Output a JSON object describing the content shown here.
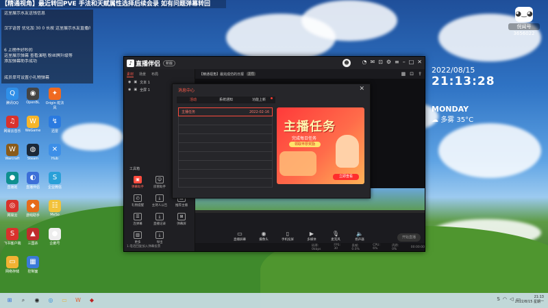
{
  "banner_text": "【精通视角】最近转回PVE 手法和天赋属性选择后续会录 如有问题弹幕转回",
  "chat": [
    "这里展示水友送钱信息",
    "汉字语音  优化加 30 0 长按 这里展示水友直播间",
    "6 上榜件好吵的",
    "这里展示弹幕  查看演唱  粉丝牌升级等",
    "添加弹幕助手成功",
    "成员单可设置小礼物弹幕"
  ],
  "desktop_icons": [
    {
      "label": "腾讯QQ",
      "glyph": "Q",
      "color": "#2f8fe8"
    },
    {
      "label": "OpenBL",
      "glyph": "◉",
      "color": "#444"
    },
    {
      "label": "Origin 蛇法风",
      "glyph": "✦",
      "color": "#f06a20"
    },
    {
      "label": "网易云音乐",
      "glyph": "♫",
      "color": "#d8322c"
    },
    {
      "label": "WeGame",
      "glyph": "W",
      "color": "#f6b52b"
    },
    {
      "label": "迅雷",
      "glyph": "↯",
      "color": "#2a7ae0"
    },
    {
      "label": "Warcraft",
      "glyph": "W",
      "color": "#8a5b1a"
    },
    {
      "label": "Steam",
      "glyph": "◍",
      "color": "#1b2838"
    },
    {
      "label": "Hub",
      "glyph": "✕",
      "color": "#3d8fe8"
    },
    {
      "label": "直播姬",
      "glyph": "●",
      "color": "#0f8f8f"
    },
    {
      "label": "直播伴侣",
      "glyph": "◐",
      "color": "#3c6fd8"
    },
    {
      "label": "企业微信",
      "glyph": "S",
      "color": "#2aa0d8"
    },
    {
      "label": "网易云",
      "glyph": "◎",
      "color": "#d8322c"
    },
    {
      "label": "游戏助手",
      "glyph": "◆",
      "color": "#e66b1a"
    },
    {
      "label": "MeSo",
      "glyph": "☷",
      "color": "#f2c23a"
    },
    {
      "label": "飞书客户端",
      "glyph": "S",
      "color": "#d8322c"
    },
    {
      "label": "三国杀",
      "glyph": "▲",
      "color": "#c02c2c"
    },
    {
      "label": "企鹅号",
      "glyph": "●",
      "color": "#eee"
    },
    {
      "label": "网络存储",
      "glyph": "▭",
      "color": "#f2b233"
    },
    {
      "label": "控制面",
      "glyph": "▦",
      "color": "#3a7ad8"
    }
  ],
  "clock": {
    "date": "2022/08/15",
    "time": "21:13:28",
    "day": "MONDAY",
    "weather": "多雾 35°C"
  },
  "profile": {
    "name": "倪闻号",
    "id": "3656022",
    "avatar": "◕‿◕"
  },
  "app": {
    "title": "直播伴侣",
    "version": "新版",
    "left_tabs": [
      "素材",
      "场景",
      "布局"
    ],
    "scenes": [
      "文本 1",
      "全屏 1"
    ],
    "tools_title": "工具箱",
    "tools": [
      {
        "label": "弹幕助手",
        "glyph": "▣",
        "active": true
      },
      {
        "label": "房管助手",
        "glyph": "☺",
        "active": false
      },
      {
        "label": "投屏主播",
        "glyph": "◧",
        "active": false
      },
      {
        "label": "礼物提醒",
        "glyph": "◴",
        "active": false
      },
      {
        "label": "主持人公告",
        "glyph": "⤓",
        "active": false
      },
      {
        "label": "推荐主播",
        "glyph": "▤",
        "active": false
      },
      {
        "label": "连弹幕",
        "glyph": "☰",
        "active": false
      },
      {
        "label": "直播记录",
        "glyph": "⤓",
        "active": false
      },
      {
        "label": "弹幕屏",
        "glyph": "⊞",
        "active": false
      },
      {
        "label": "更多",
        "glyph": "▥",
        "active": false
      },
      {
        "label": "导出",
        "glyph": "⤓",
        "active": false
      }
    ],
    "left_footer": "1.电话回复加入弹幕投票",
    "live_title": "【精通视角】最完成仿的日报",
    "live_tag": "正在",
    "controls": [
      {
        "label": "直播屏幕",
        "glyph": "▭"
      },
      {
        "label": "摄像头",
        "glyph": "◉"
      },
      {
        "label": "手机投屏",
        "glyph": "▯"
      },
      {
        "label": "多媒体",
        "glyph": "▶"
      },
      {
        "label": "麦克风",
        "glyph": "🎙"
      },
      {
        "label": "扬声器",
        "glyph": "🔈"
      }
    ],
    "start_live": "开始直播",
    "status": [
      "码率: 0kbps",
      "FPS: 30",
      "丢帧: 0.0%",
      "CPU: 6%",
      "内存: 0%",
      "00:00:00"
    ]
  },
  "modal": {
    "title": "消息中心",
    "tabs": [
      {
        "label": "活动",
        "active": true,
        "dot": false
      },
      {
        "label": "系统通知",
        "active": false,
        "dot": false
      },
      {
        "label": "功能上新",
        "active": false,
        "dot": true
      }
    ],
    "messages": [
      {
        "title": "主播任务",
        "date": "2022-02-16",
        "active": true
      },
      {
        "title": "",
        "date": "",
        "active": false
      },
      {
        "title": "",
        "date": "",
        "active": false
      },
      {
        "title": "",
        "date": "",
        "active": false
      },
      {
        "title": "",
        "date": "",
        "active": false
      },
      {
        "title": "",
        "date": "",
        "active": false
      },
      {
        "title": "",
        "date": "",
        "active": false
      },
      {
        "title": "",
        "date": "",
        "active": false
      },
      {
        "title": "",
        "date": "",
        "active": false
      }
    ],
    "promo": {
      "title": "主播任务",
      "subtitle": "完成每日任务",
      "pill": "领取丰厚奖励",
      "button": "立即查看"
    }
  },
  "taskbar": {
    "icons": [
      {
        "name": "windows-start-icon",
        "glyph": "⊞",
        "color": "#2a6ad8"
      },
      {
        "name": "search-icon",
        "glyph": "⌕",
        "color": "#333"
      },
      {
        "name": "obs-icon",
        "glyph": "◉",
        "color": "#222"
      },
      {
        "name": "browser-icon",
        "glyph": "◎",
        "color": "#2a8ad8"
      },
      {
        "name": "folder-icon",
        "glyph": "▭",
        "color": "#e6b233"
      },
      {
        "name": "wegame-icon",
        "glyph": "W",
        "color": "#e05a2a"
      },
      {
        "name": "game-icon",
        "glyph": "◆",
        "color": "#b22"
      }
    ],
    "time": "21:13",
    "date": "2022/8/15 星期一"
  }
}
